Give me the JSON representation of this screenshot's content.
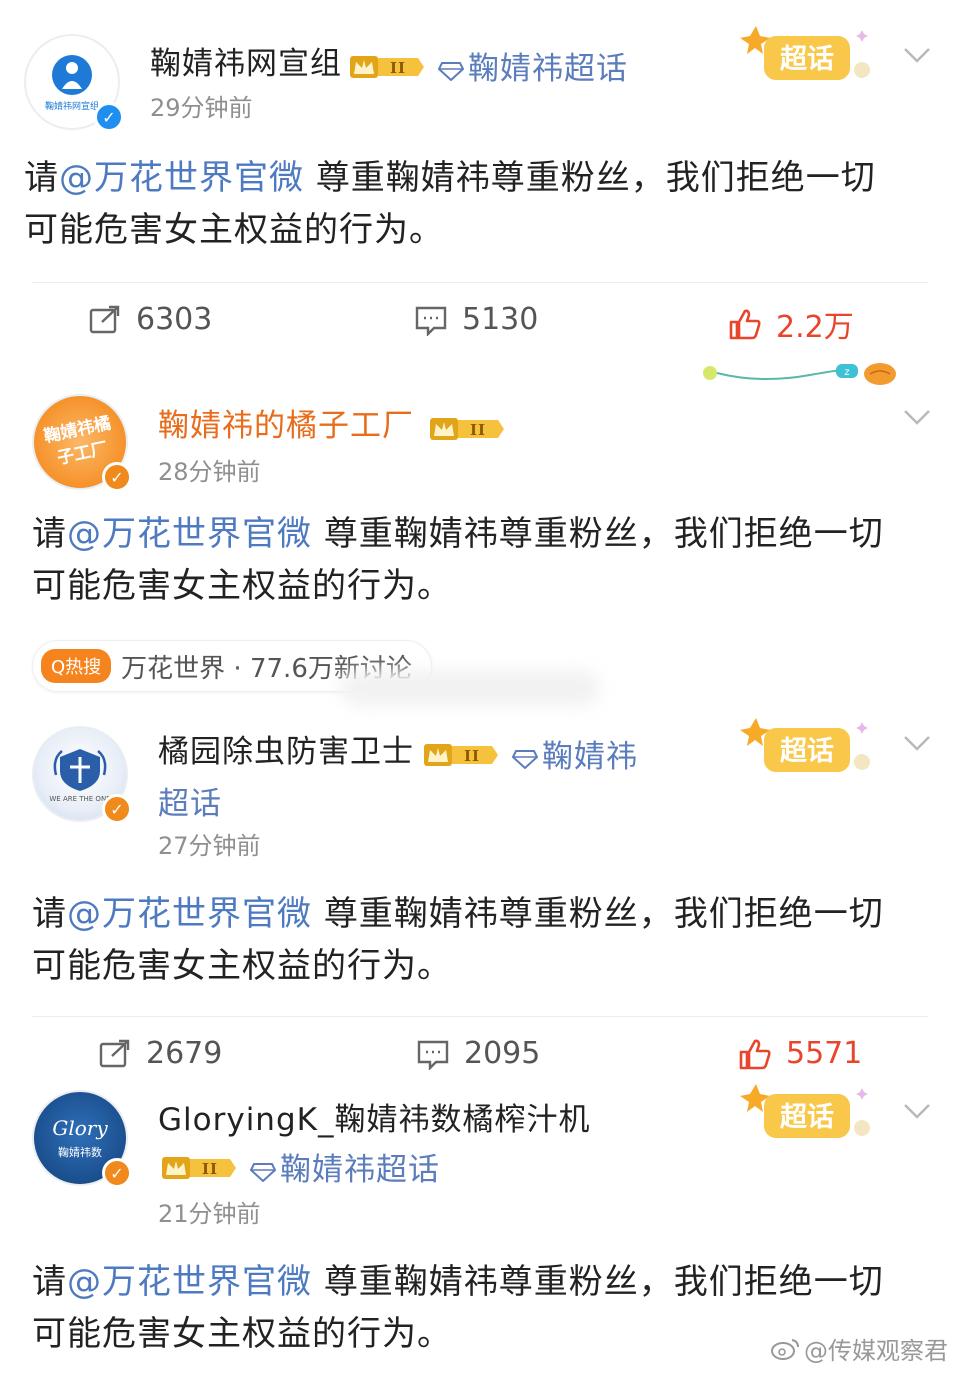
{
  "posts": [
    {
      "username": "鞠婧祎网宣组",
      "avatar_label": "鞠婧祎网宣组",
      "verified": "blue",
      "crown_level": "II",
      "topic": "鞠婧祎超话",
      "supertag": "超话",
      "time": "29分钟前",
      "content_prefix": "请",
      "mention": "@万花世界官微",
      "content_rest": "尊重鞠婧祎尊重粉丝，我们拒绝一切",
      "content_line2": "可能危害女主权益的行为。",
      "repost": "6303",
      "comment": "5130",
      "like": "2.2万"
    },
    {
      "username": "鞠婧祎的橘子工厂",
      "avatar_label": "鞠婧祎橘子工厂",
      "verified": "orange",
      "crown_level": "II",
      "time": "28分钟前",
      "content_prefix": "请",
      "mention": "@万花世界官微",
      "content_rest": "尊重鞠婧祎尊重粉丝，我们拒绝一切",
      "content_line2": "可能危害女主权益的行为。"
    },
    {
      "username": "橘园除虫防害卫士",
      "avatar_label": "WE ARE THE ONE",
      "verified": "orange",
      "crown_level": "II",
      "topic": "鞠婧祎",
      "topic_line2": "超话",
      "supertag": "超话",
      "time": "27分钟前",
      "content_prefix": "请",
      "mention": "@万花世界官微",
      "content_rest": "尊重鞠婧祎尊重粉丝，我们拒绝一切",
      "content_line2": "可能危害女主权益的行为。",
      "repost": "2679",
      "comment": "2095",
      "like": "5571"
    },
    {
      "username": "GloryingK_鞠婧祎数橘榨汁机",
      "avatar_label": "鞠婧祎数",
      "verified": "orange",
      "crown_level": "II",
      "topic": "鞠婧祎超话",
      "supertag": "超话",
      "time": "21分钟前",
      "content_prefix": "请",
      "mention": "@万花世界官微",
      "content_rest": "尊重鞠婧祎尊重粉丝，我们拒绝一切",
      "content_line2": "可能危害女主权益的行为。"
    }
  ],
  "hot_search": {
    "badge": "Q热搜",
    "text": "万花世界 · 77.6万新讨论"
  },
  "watermark": "@传媒观察君",
  "colors": {
    "mention": "#4d7ac1",
    "like": "#e8452c",
    "verified_blue": "#1f8ef1",
    "verified_orange": "#f08a1c",
    "supertag": "#f7b733"
  }
}
